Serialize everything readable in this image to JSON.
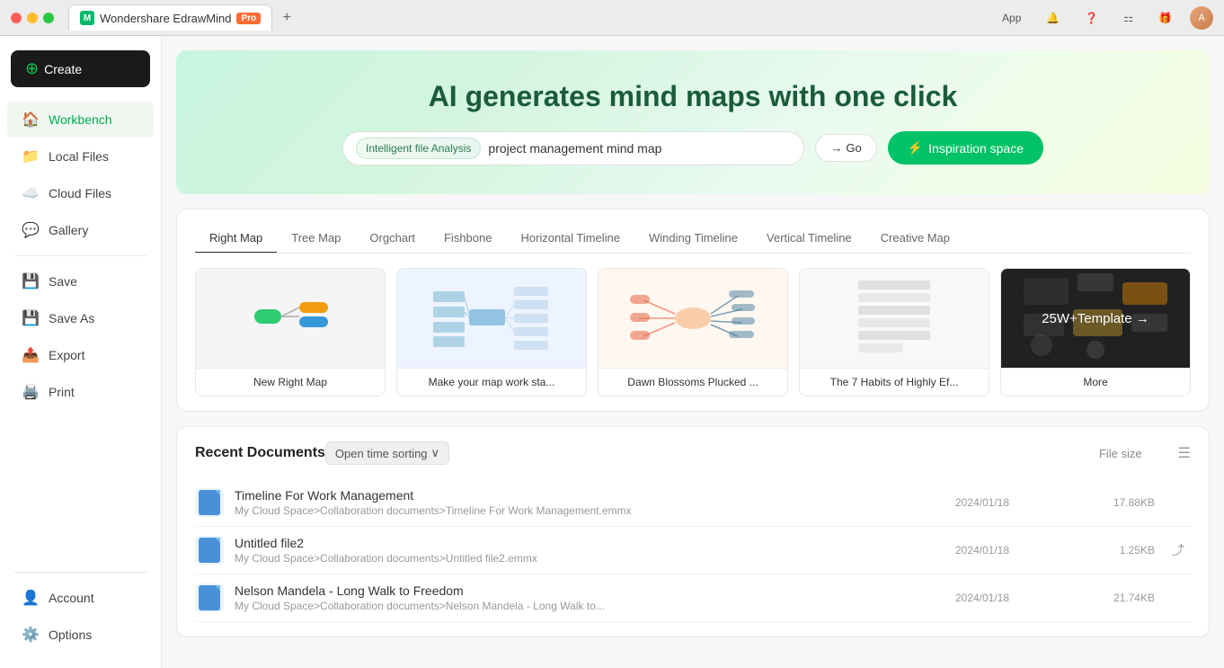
{
  "titlebar": {
    "app_name": "Wondershare EdrawMind",
    "pro_label": "Pro",
    "tab_add_label": "+",
    "app_btn": "App",
    "new_tab_title": "Wondershare EdrawMind"
  },
  "header_buttons": {
    "app": "App",
    "notification_icon": "bell-icon",
    "help_icon": "help-icon",
    "grid_icon": "grid-icon",
    "gift_icon": "gift-icon"
  },
  "sidebar": {
    "create_label": "Create",
    "items": [
      {
        "id": "workbench",
        "label": "Workbench",
        "icon": "🏠",
        "active": true
      },
      {
        "id": "local-files",
        "label": "Local Files",
        "icon": "📁",
        "active": false
      },
      {
        "id": "cloud-files",
        "label": "Cloud Files",
        "icon": "☁️",
        "active": false
      },
      {
        "id": "gallery",
        "label": "Gallery",
        "icon": "💬",
        "active": false
      }
    ],
    "divider": true,
    "bottom_items": [
      {
        "id": "save",
        "label": "Save",
        "icon": "💾",
        "active": false
      },
      {
        "id": "save-as",
        "label": "Save As",
        "icon": "💾",
        "active": false
      },
      {
        "id": "export",
        "label": "Export",
        "icon": "📤",
        "active": false
      },
      {
        "id": "print",
        "label": "Print",
        "icon": "🖨️",
        "active": false
      }
    ],
    "account_label": "Account",
    "options_label": "Options"
  },
  "hero": {
    "title": "AI generates mind maps with one click",
    "input_tag": "Intelligent file Analysis",
    "input_value": "project management mind map",
    "input_placeholder": "project management mind map",
    "go_arrow": "→",
    "go_label": "Go",
    "inspiration_icon": "⚡",
    "inspiration_label": "Inspiration space"
  },
  "templates": {
    "tabs": [
      {
        "id": "right-map",
        "label": "Right Map",
        "active": true
      },
      {
        "id": "tree-map",
        "label": "Tree Map",
        "active": false
      },
      {
        "id": "orgchart",
        "label": "Orgchart",
        "active": false
      },
      {
        "id": "fishbone",
        "label": "Fishbone",
        "active": false
      },
      {
        "id": "horizontal-timeline",
        "label": "Horizontal Timeline",
        "active": false
      },
      {
        "id": "winding-timeline",
        "label": "Winding Timeline",
        "active": false
      },
      {
        "id": "vertical-timeline",
        "label": "Vertical Timeline",
        "active": false
      },
      {
        "id": "creative-map",
        "label": "Creative Map",
        "active": false
      }
    ],
    "cards": [
      {
        "id": "new-right-map",
        "name": "New Right Map",
        "type": "simple"
      },
      {
        "id": "work-sta",
        "name": "Make your map work sta...",
        "type": "complex-blue"
      },
      {
        "id": "dawn-blossoms",
        "name": "Dawn Blossoms Plucked ...",
        "type": "dawn"
      },
      {
        "id": "habits",
        "name": "The 7 Habits of Highly Ef...",
        "type": "habits"
      }
    ],
    "more_count": "25W+",
    "more_label": "Template",
    "more_arrow": "→",
    "more_card_label": "More"
  },
  "recent": {
    "title": "Recent Documents",
    "sort_label": "Open time sorting",
    "sort_arrow": "∨",
    "file_size_label": "File size",
    "documents": [
      {
        "id": "doc1",
        "name": "Timeline For Work Management",
        "path": "My Cloud Space>Collaboration documents>Timeline For Work Management.emmx",
        "date": "2024/01/18",
        "size": "17.88KB",
        "shared": false
      },
      {
        "id": "doc2",
        "name": "Untitled file2",
        "path": "My Cloud Space>Collaboration documents>Untitled file2.emmx",
        "date": "2024/01/18",
        "size": "1.25KB",
        "shared": true
      },
      {
        "id": "doc3",
        "name": "Nelson Mandela - Long Walk to Freedom",
        "path": "My Cloud Space>Collaboration documents>Nelson Mandela - Long Walk to...",
        "date": "2024/01/18",
        "size": "21.74KB",
        "shared": false
      }
    ]
  }
}
